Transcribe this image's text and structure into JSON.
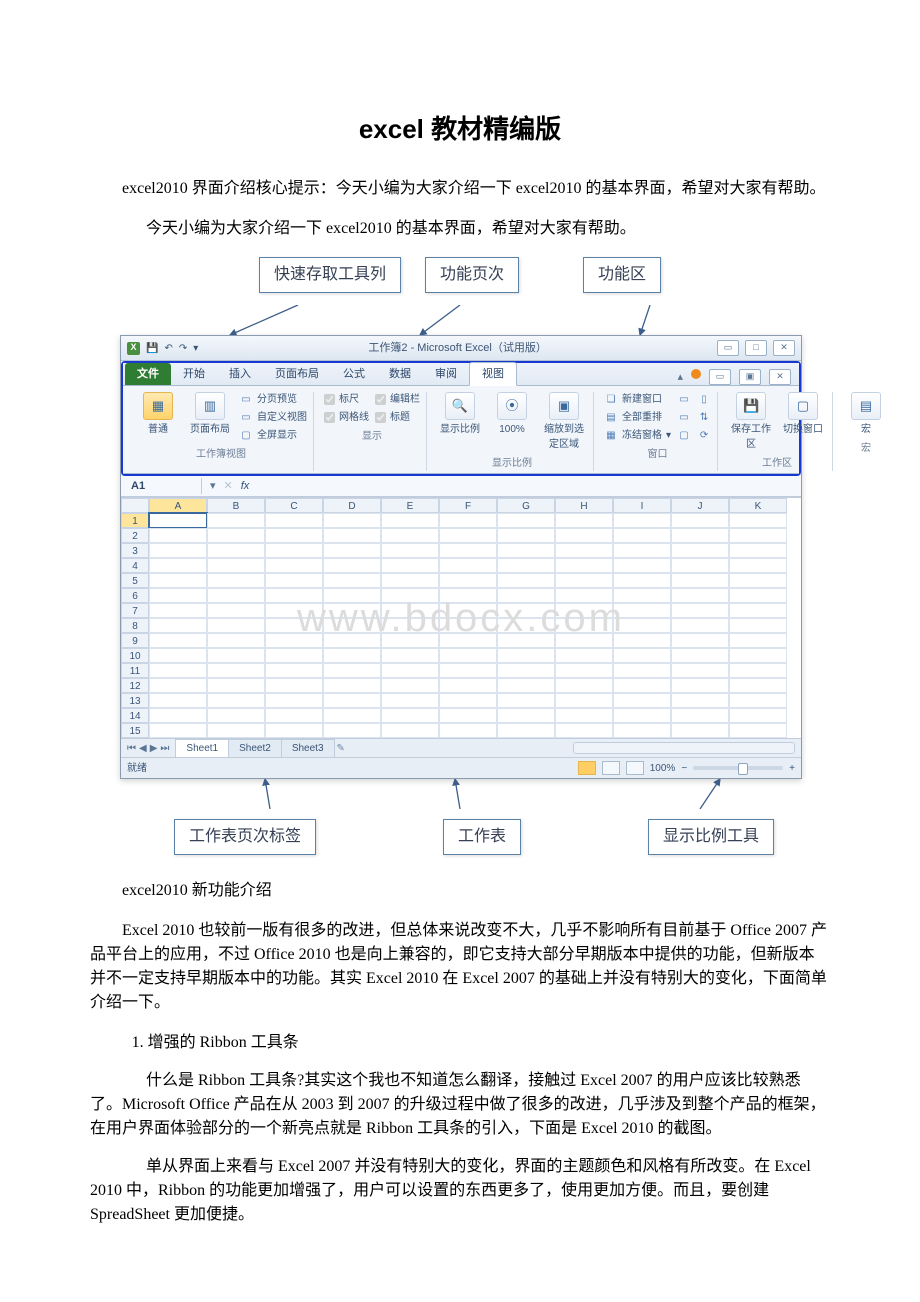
{
  "article": {
    "title": "excel 教材精编版",
    "intro1": "excel2010 界面介绍核心提示：今天小编为大家介绍一下 excel2010 的基本界面，希望对大家有帮助。",
    "intro2": "今天小编为大家介绍一下 excel2010 的基本界面，希望对大家有帮助。",
    "section_label": "excel2010 新功能介绍",
    "p1": "Excel 2010 也较前一版有很多的改进，但总体来说改变不大，几乎不影响所有目前基于 Office 2007 产品平台上的应用，不过 Office 2010 也是向上兼容的，即它支持大部分早期版本中提供的功能，但新版本并不一定支持早期版本中的功能。其实 Excel 2010 在 Excel 2007 的基础上并没有特别大的变化，下面简单介绍一下。",
    "s1_title": "1. 增强的 Ribbon 工具条",
    "s1_p1": "什么是 Ribbon 工具条?其实这个我也不知道怎么翻译，接触过 Excel 2007 的用户应该比较熟悉了。Microsoft Office 产品在从 2003 到 2007 的升级过程中做了很多的改进，几乎涉及到整个产品的框架，在用户界面体验部分的一个新亮点就是 Ribbon 工具条的引入，下面是 Excel 2010 的截图。",
    "s1_p2": "单从界面上来看与 Excel 2007 并没有特别大的变化，界面的主题颜色和风格有所改变。在 Excel 2010 中，Ribbon 的功能更加增强了，用户可以设置的东西更多了，使用更加方便。而且，要创建 SpreadSheet 更加便捷。"
  },
  "callouts": {
    "qat": "快速存取工具列",
    "tabs": "功能页次",
    "ribbon": "功能区",
    "sheet_tabs": "工作表页次标签",
    "worksheet": "工作表",
    "zoom": "显示比例工具"
  },
  "excel": {
    "titlebar": "工作簿2 - Microsoft Excel（试用版）",
    "window_buttons": {
      "min": "▭",
      "max": "□",
      "close": "✕",
      "inner_min": "▭",
      "inner_max": "▣",
      "inner_close": "✕"
    },
    "qat_icons": {
      "save": "💾",
      "undo": "↶",
      "redo": "↷",
      "dropdown": "▾"
    },
    "tabs": {
      "file": "文件",
      "home": "开始",
      "insert": "插入",
      "layout": "页面布局",
      "formula": "公式",
      "data": "数据",
      "review": "审阅",
      "view": "视图"
    },
    "ribbon": {
      "view_group": {
        "normal": "普通",
        "page_layout": "页面布局",
        "title": "工作簿视图",
        "preview": "分页预览",
        "custom": "自定义视图",
        "full": "全屏显示"
      },
      "show_group": {
        "ruler": "标尺",
        "formula_bar": "编辑栏",
        "grid": "网格线",
        "headings": "标题",
        "title": "显示"
      },
      "zoom_group": {
        "zoom": "显示比例",
        "hundred": "100%",
        "fit": "缩放到选定区域",
        "title": "显示比例"
      },
      "window_group": {
        "newwin": "新建窗口",
        "arrange": "全部重排",
        "freeze": "冻结窗格",
        "split_icon": "▭",
        "hide_icon": "▭",
        "side_icon": "▯",
        "title": "窗口"
      },
      "workspace_group": {
        "save": "保存工作区",
        "switch": "切换窗口",
        "title": "工作区"
      },
      "macro_group": {
        "macro": "宏",
        "title": "宏"
      }
    },
    "namebox": "A1",
    "fx_label": "fx",
    "columns": [
      "A",
      "B",
      "C",
      "D",
      "E",
      "F",
      "G",
      "H",
      "I",
      "J",
      "K"
    ],
    "rows": [
      "1",
      "2",
      "3",
      "4",
      "5",
      "6",
      "7",
      "8",
      "9",
      "10",
      "11",
      "12",
      "13",
      "14",
      "15"
    ],
    "sheet_tabs": {
      "s1": "Sheet1",
      "s2": "Sheet2",
      "s3": "Sheet3"
    },
    "status": {
      "ready": "就绪",
      "zoom": "100%",
      "minus": "−",
      "plus": "+"
    },
    "watermark": "www.bdocx.com"
  }
}
